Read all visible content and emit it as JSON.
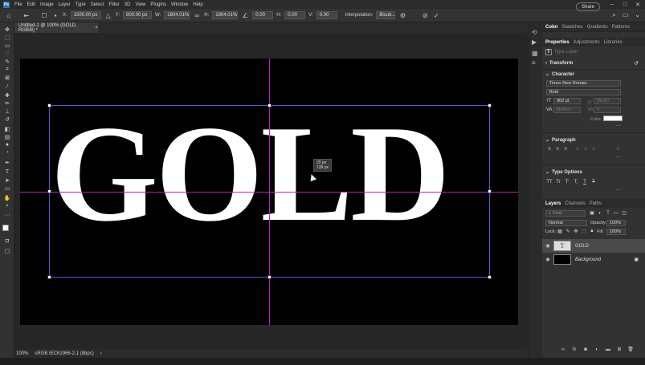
{
  "menubar": {
    "logo": "Ps",
    "items": [
      "File",
      "Edit",
      "Image",
      "Layer",
      "Type",
      "Select",
      "Filter",
      "3D",
      "View",
      "Plugins",
      "Window",
      "Help"
    ]
  },
  "options": {
    "x_label": "X:",
    "x_value": "1500.00 px",
    "y_label": "Y:",
    "y_value": "800.00 px",
    "w_label": "W:",
    "w_value": "1804.01%",
    "h_label": "H:",
    "h_value": "1804.01%",
    "angle_value": "0.00",
    "hskew_label": "H:",
    "hskew_value": "0.00",
    "vskew_label": "V:",
    "vskew_value": "0.00",
    "interp_label": "Interpolation:",
    "interp_value": "Bicub...",
    "share_label": "Share"
  },
  "document": {
    "tab_title": "Untitled-1 @ 100% (GOLD, RGB/8) *",
    "tab_close": "×",
    "text": "GOLD",
    "hud_line1": "20 px",
    "hud_line2": "139 px"
  },
  "status": {
    "zoom": "100%",
    "profile": "sRGB IEC61966-2.1 (8bpc)"
  },
  "panels": {
    "top_tabs": [
      "Color",
      "Swatches",
      "Gradients",
      "Patterns"
    ],
    "prop_tabs": [
      "Properties",
      "Adjustments",
      "Libraries"
    ],
    "type_layer_label": "Type Layer",
    "transform_label": "Transform",
    "character_label": "Character",
    "font_family": "Times New Roman",
    "font_style": "Bold",
    "font_size": "902 pt",
    "leading": "(Auto)",
    "kerning": "Metrics",
    "tracking": "0",
    "color_label": "Color:",
    "paragraph_label": "Paragraph",
    "type_options_label": "Type Options",
    "type_option_glyphs": [
      "TT",
      "Tr",
      "T'",
      "T,",
      "T",
      "T"
    ]
  },
  "layers": {
    "tabs": [
      "Layers",
      "Channels",
      "Paths"
    ],
    "filter_placeholder": "Kind",
    "blend_mode": "Normal",
    "opacity_label": "Opacity:",
    "opacity_value": "100%",
    "lock_label": "Lock:",
    "fill_label": "Fill:",
    "fill_value": "100%",
    "items": [
      {
        "name": "GOLD",
        "type": "text"
      },
      {
        "name": "Background",
        "type": "pixel"
      }
    ]
  },
  "colors": {
    "accent": "#2d6fbd",
    "guide": "#c020c0",
    "bbox": "#5a5ad8",
    "text": "#ffffff",
    "document_bg": "#000000"
  }
}
